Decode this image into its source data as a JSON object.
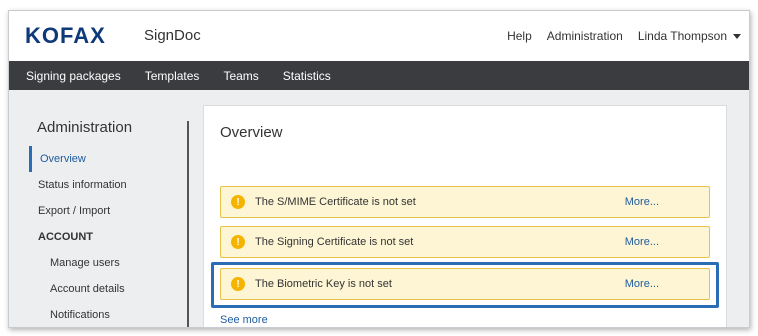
{
  "header": {
    "logo": "KOFAX",
    "product": "SignDoc",
    "links": {
      "help": "Help",
      "administration": "Administration",
      "user": "Linda Thompson"
    }
  },
  "nav": {
    "items": [
      "Signing packages",
      "Templates",
      "Teams",
      "Statistics"
    ]
  },
  "sidebar": {
    "title": "Administration",
    "items": [
      "Overview",
      "Status information",
      "Export / Import"
    ],
    "section": "ACCOUNT",
    "sub_items": [
      "Manage users",
      "Account details",
      "Notifications"
    ]
  },
  "main": {
    "title": "Overview",
    "alerts": [
      {
        "text": "The S/MIME Certificate is not set",
        "link": "More..."
      },
      {
        "text": "The Signing Certificate is not set",
        "link": "More..."
      },
      {
        "text": "The Biometric Key is not set",
        "link": "More..."
      }
    ],
    "see_more": "See more"
  },
  "colors": {
    "brand": "#0f3a79",
    "nav_bg": "#3b3c40",
    "alert_bg": "#fdf5d4",
    "alert_border": "#e6c24b",
    "link": "#1f5c9e",
    "highlight": "#2a6db5"
  },
  "icons": {
    "alert": "exclamation-circle-icon",
    "user_menu": "caret-down-icon"
  }
}
